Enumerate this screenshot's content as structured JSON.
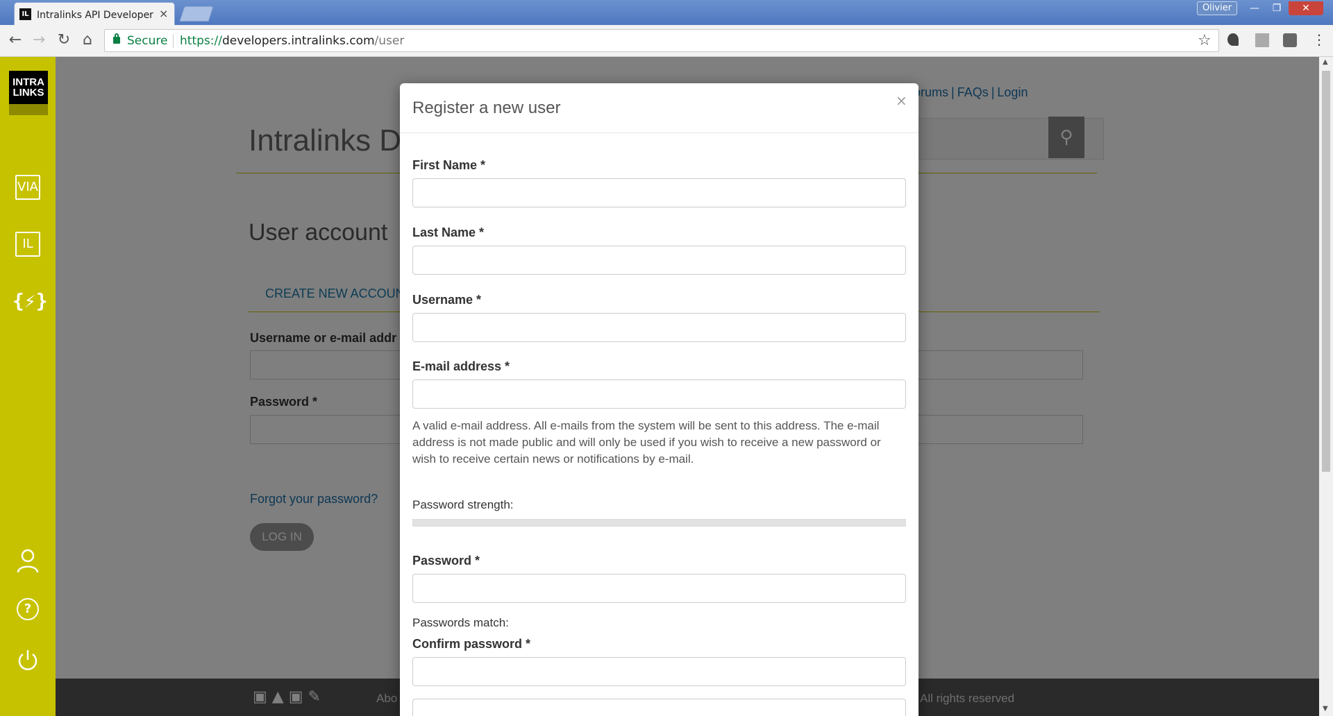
{
  "browser": {
    "tab_title": "Intralinks API Developer Portal",
    "tab_favicon": "IL",
    "tab_close": "×",
    "user_badge": "Olivier",
    "url_secure_label": "Secure",
    "url_scheme": "https://",
    "url_host": "developers.intralinks.com",
    "url_path": "/user",
    "icons": [
      "back-icon",
      "forward-icon",
      "reload-icon",
      "home-icon",
      "lock-icon",
      "star-icon",
      "menu-icon"
    ]
  },
  "sidebar": {
    "logo_line1": "INTRA",
    "logo_line2": "LINKS",
    "items": [
      {
        "label": "VIA",
        "icon": "via-icon"
      },
      {
        "label": "IL",
        "icon": "il-icon"
      },
      {
        "label": "{⚡}",
        "icon": "api-icon"
      }
    ],
    "bottom": [
      {
        "icon": "user-icon",
        "glyph": "👤"
      },
      {
        "icon": "help-icon",
        "glyph": "?"
      },
      {
        "icon": "power-icon",
        "glyph": "⏻"
      }
    ]
  },
  "background_page": {
    "site_title": "Intralinks De",
    "top_links": {
      "forums": "Forums",
      "faqs": "FAQs",
      "login": "Login",
      "sep": "|"
    },
    "page_heading": "User account",
    "tab_create": "CREATE NEW ACCOUN",
    "username_label": "Username or e-mail addr",
    "password_label": "Password *",
    "forgot_link": "Forgot your password?",
    "login_button": "LOG IN",
    "footer_about": "Abo",
    "footer_rights": "All rights reserved"
  },
  "modal": {
    "title": "Register a new user",
    "close": "×",
    "fields": {
      "first_name": {
        "label": "First Name *",
        "value": ""
      },
      "last_name": {
        "label": "Last Name *",
        "value": ""
      },
      "username": {
        "label": "Username *",
        "value": ""
      },
      "email": {
        "label": "E-mail address *",
        "value": ""
      },
      "password": {
        "label": "Password *",
        "value": ""
      },
      "confirm_password": {
        "label": "Confirm password *",
        "value": ""
      }
    },
    "email_help": "A valid e-mail address. All e-mails from the system will be sent to this address. The e-mail address is not made public and will only be used if you wish to receive a new password or wish to receive certain news or notifications by e-mail.",
    "password_strength_label": "Password strength:",
    "password_strength_value": 0,
    "passwords_match_label": "Passwords match:"
  }
}
